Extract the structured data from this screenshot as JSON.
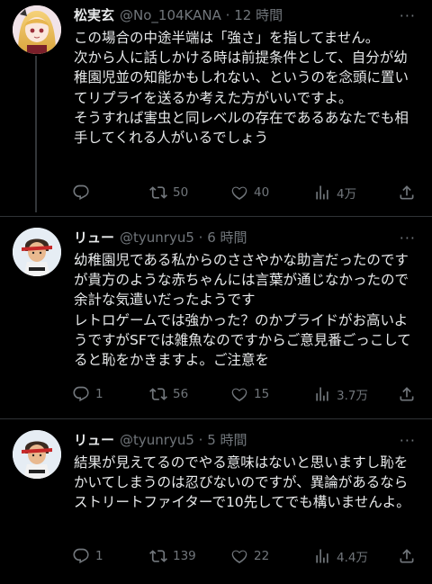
{
  "tweets": [
    {
      "name": "松実玄",
      "handle": "@No_104KANA",
      "dot": "·",
      "time": "12 時間",
      "more": "···",
      "text": "この場合の中途半端は「強さ」を指してません。\n次から人に話しかける時は前提条件として、自分が幼稚園児並の知能かもしれない、というのを念頭に置いてリプライを送るか考えた方がいいですよ。\nそうすれば害虫と同レベルの存在であるあなたでも相手してくれる人がいるでしょう",
      "replies": "",
      "retweets": "50",
      "likes": "40",
      "views": "4万"
    },
    {
      "name": "リュー",
      "handle": "@tyunryu5",
      "dot": "·",
      "time": "6 時間",
      "more": "···",
      "text": "幼稚園児である私からのささやかな助言だったのですが貴方のような赤ちゃんには言葉が通じなかったので余計な気遣いだったようです\nレトロゲームでは強かった？のかプライドがお高いようですがSFでは雑魚なのですからご意見番ごっこしてると恥をかきますよ。ご注意を",
      "replies": "1",
      "retweets": "56",
      "likes": "15",
      "views": "3.7万"
    },
    {
      "name": "リュー",
      "handle": "@tyunryu5",
      "dot": "·",
      "time": "5 時間",
      "more": "···",
      "text": "結果が見えてるのでやる意味はないと思いますし恥をかいてしまうのは忍びないのですが、異論があるならストリートファイターで10先してでも構いませんよ。",
      "replies": "1",
      "retweets": "139",
      "likes": "22",
      "views": "4.4万"
    }
  ],
  "icons": [
    "reply-icon",
    "retweet-icon",
    "like-icon",
    "views-icon",
    "share-icon"
  ],
  "colors": {
    "background": "#000000",
    "text": "#e7e9ea",
    "muted": "#71767b",
    "divider": "#2f3336"
  }
}
